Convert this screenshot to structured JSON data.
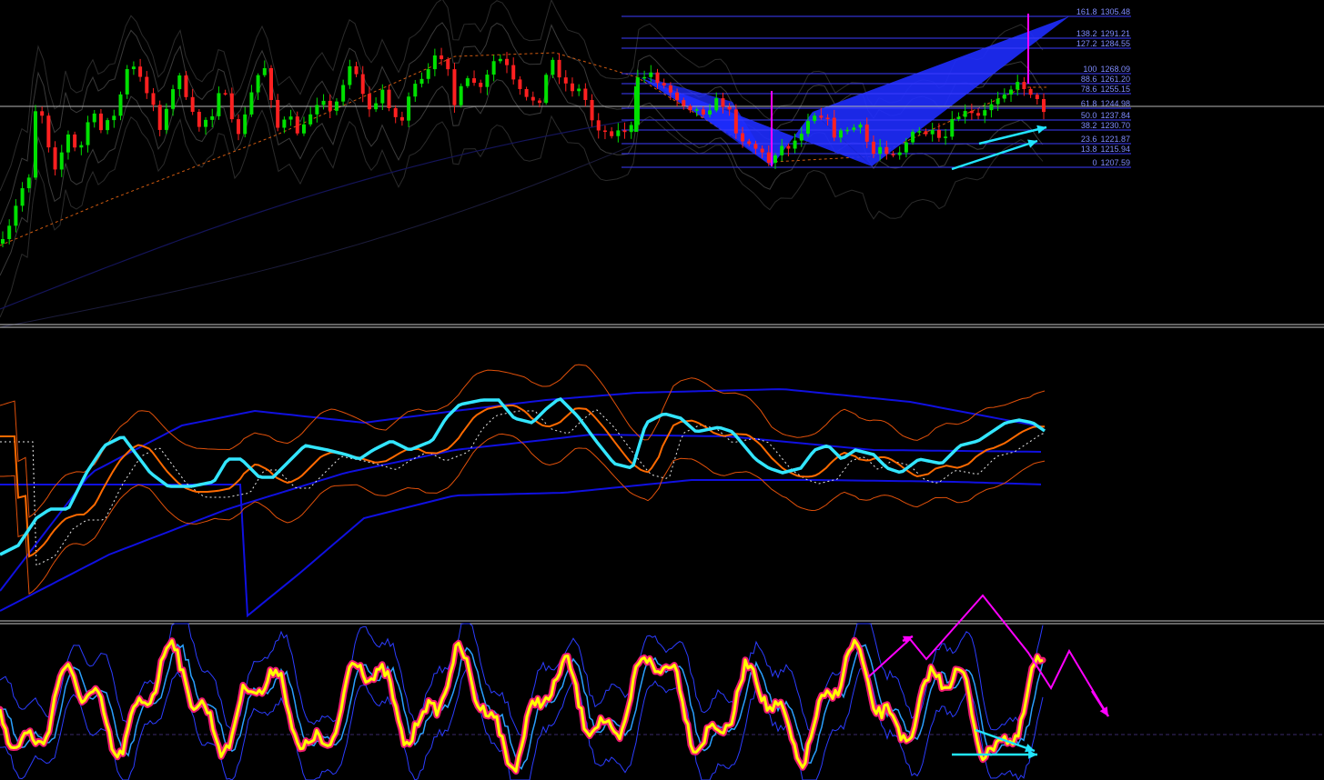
{
  "chart_data": {
    "type": "line",
    "panels": [
      {
        "name": "",
        "kind": "candlestick price with bollinger bands and fibonacci retracement",
        "fibonacci_levels": [
          {
            "ratio": "161.8",
            "price": "1305.48"
          },
          {
            "ratio": "138.2",
            "price": "1291.21"
          },
          {
            "ratio": "127.2",
            "price": "1284.55"
          },
          {
            "ratio": "100",
            "price": "1268.09"
          },
          {
            "ratio": "88.6",
            "price": "1261.20"
          },
          {
            "ratio": "78.6",
            "price": "1255.15"
          },
          {
            "ratio": "61.8",
            "price": "1244.98"
          },
          {
            "ratio": "50.0",
            "price": "1237.84"
          },
          {
            "ratio": "38.2",
            "price": "1230.70"
          },
          {
            "ratio": "23.6",
            "price": "1221.87"
          },
          {
            "ratio": "13.8",
            "price": "1215.94"
          },
          {
            "ratio": "0",
            "price": "1207.59"
          }
        ],
        "bar_count": 160,
        "price_range": [
          1160,
          1310
        ],
        "harmonic_pattern": "bat",
        "annotations": [
          "two cyan arrows pointing up-right (higher lows)",
          "magenta vertical spike lines"
        ]
      },
      {
        "name": "",
        "kind": "oscillator with moving averages and bands",
        "series": [
          "cyan main line",
          "orange moving average",
          "white dotted average",
          "orange envelope bands",
          "blue long bands"
        ]
      },
      {
        "name": "",
        "kind": "stochastic-style oscillator",
        "series": [
          "yellow main line with magenta dots",
          "light blue signal",
          "blue envelope"
        ],
        "annotations": [
          "magenta zigzag projection",
          "cyan arrows pointing right-down (lower lows)"
        ]
      }
    ],
    "colors": {
      "background": "#000000",
      "bull_candle": "#00e000",
      "bear_candle": "#ff2020",
      "fib_line": "#3b3bff",
      "fib_text": "#7f8cff",
      "pattern_fill": "#1e2cff",
      "spike": "#ff00ff",
      "arrow": "#22e5ff",
      "osc_main": "#33e6ff",
      "osc_ma": "#ff6a00",
      "band_blue": "#1010e0",
      "stoch_main": "#ffff00",
      "stoch_dots": "#ff1e78",
      "stoch_signal": "#2aa0ff",
      "zigzag": "#ff00ff"
    },
    "grid": false,
    "legend": "none"
  }
}
